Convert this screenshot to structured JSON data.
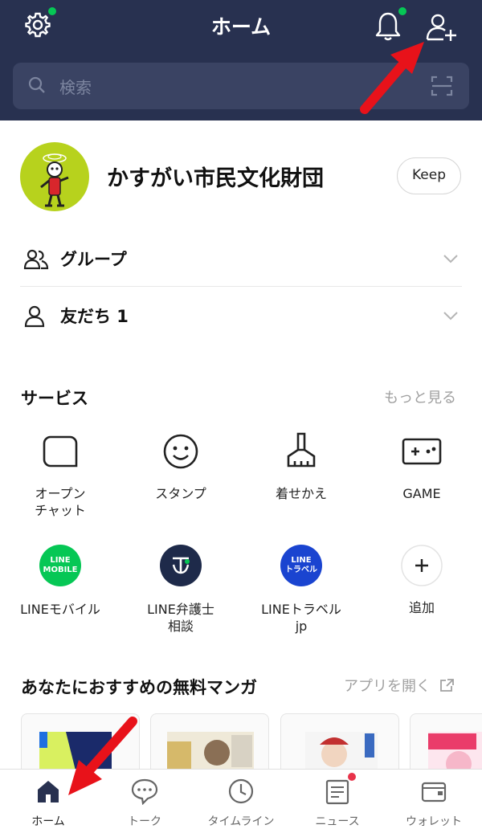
{
  "header": {
    "title": "ホーム",
    "search_placeholder": "検索"
  },
  "profile": {
    "name": "かすがい市民文化財団",
    "keep_label": "Keep"
  },
  "rows": [
    {
      "label": "グループ"
    },
    {
      "label": "友だち 1"
    }
  ],
  "services": {
    "title": "サービス",
    "more_label": "もっと見る",
    "items": [
      {
        "label": "オープン\nチャット",
        "icon": "open-chat-icon"
      },
      {
        "label": "スタンプ",
        "icon": "sticker-icon"
      },
      {
        "label": "着せかえ",
        "icon": "theme-icon"
      },
      {
        "label": "GAME",
        "icon": "game-icon"
      },
      {
        "label": "LINEモバイル",
        "icon": "line-mobile-icon",
        "badge": "LINE\nMOBILE",
        "color": "#06c755"
      },
      {
        "label": "LINE弁護士\n相談",
        "icon": "line-lawyer-icon",
        "color": "#1e2a4a"
      },
      {
        "label": "LINEトラベル\njp",
        "icon": "line-travel-icon",
        "badge": "LINE\nトラベル",
        "color": "#1a44d0"
      },
      {
        "label": "追加",
        "icon": "add-icon"
      }
    ]
  },
  "manga": {
    "title": "あなたにおすすめの無料マンガ",
    "open_app_label": "アプリを開く"
  },
  "nav": [
    {
      "label": "ホーム",
      "icon": "home-icon",
      "active": true
    },
    {
      "label": "トーク",
      "icon": "chat-icon"
    },
    {
      "label": "タイムライン",
      "icon": "clock-icon"
    },
    {
      "label": "ニュース",
      "icon": "news-icon"
    },
    {
      "label": "ウォレット",
      "icon": "wallet-icon"
    }
  ],
  "colors": {
    "header_bg": "#283150",
    "accent_green": "#06c755",
    "notification_red": "#e8334a",
    "arrow_red": "#e8121a"
  }
}
